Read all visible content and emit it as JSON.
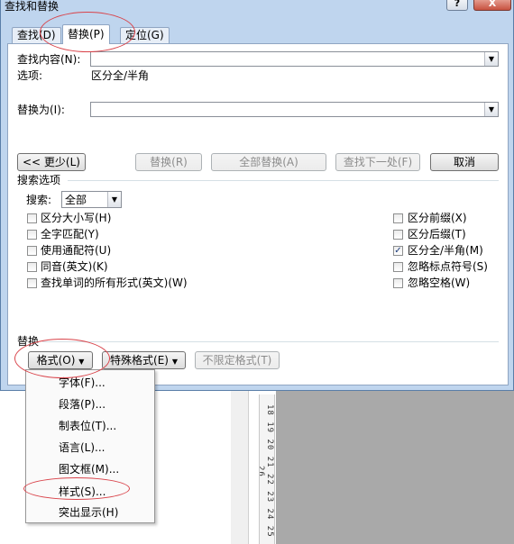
{
  "title": "查找和替换",
  "controls": {
    "help": "?",
    "close": "X"
  },
  "tabs": [
    {
      "label": "查找(D)"
    },
    {
      "label": "替换(P)"
    },
    {
      "label": "定位(G)"
    }
  ],
  "find": {
    "label": "查找内容(N):",
    "value": ""
  },
  "options": {
    "label": "选项:",
    "value": "区分全/半角"
  },
  "replace": {
    "label": "替换为(I):",
    "value": ""
  },
  "buttons": {
    "less": "<< 更少(L)",
    "replace": "替换(R)",
    "replace_all": "全部替换(A)",
    "find_next": "查找下一处(F)",
    "cancel": "取消"
  },
  "search_options": {
    "section_label": "搜索选项",
    "search_label": "搜索:",
    "search_value": "全部",
    "left": [
      {
        "label": "区分大小写(H)",
        "checked": false
      },
      {
        "label": "全字匹配(Y)",
        "checked": false
      },
      {
        "label": "使用通配符(U)",
        "checked": false
      },
      {
        "label": "同音(英文)(K)",
        "checked": false
      },
      {
        "label": "查找单词的所有形式(英文)(W)",
        "checked": false
      }
    ],
    "right": [
      {
        "label": "区分前缀(X)",
        "checked": false
      },
      {
        "label": "区分后缀(T)",
        "checked": false
      },
      {
        "label": "区分全/半角(M)",
        "checked": true
      },
      {
        "label": "忽略标点符号(S)",
        "checked": false
      },
      {
        "label": "忽略空格(W)",
        "checked": false
      }
    ]
  },
  "replace_section": {
    "label": "替换",
    "format": "格式(O)",
    "special": "特殊格式(E)",
    "no_format": "不限定格式(T)"
  },
  "format_menu": [
    "字体(F)...",
    "段落(P)...",
    "制表位(T)...",
    "语言(L)...",
    "图文框(M)...",
    "样式(S)...",
    "突出显示(H)"
  ],
  "ruler_text": "18 19 20 21 22 23 24 25 26",
  "colors": {
    "highlight_ring": "#d9434a",
    "dialog_frame": "#bfd5ee"
  }
}
